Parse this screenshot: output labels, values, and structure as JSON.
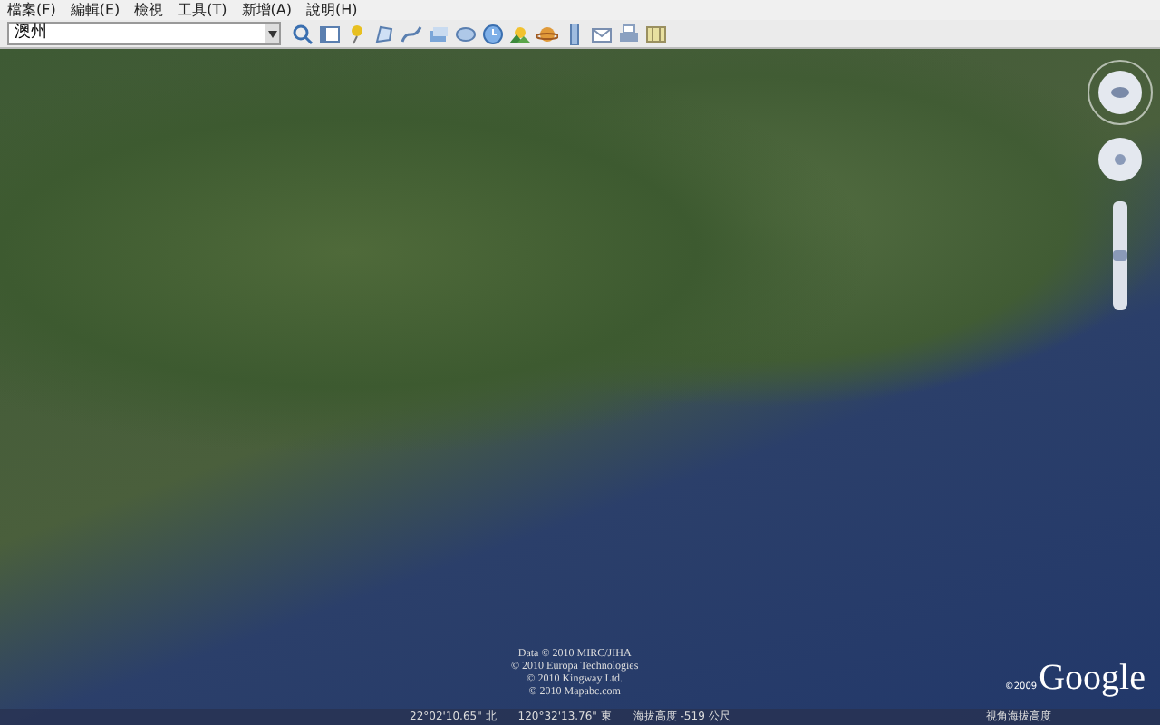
{
  "menu_bar": [
    "檔案(F)",
    "編輯(E)",
    "檢視",
    "工具(T)",
    "新增(A)",
    "說明(H)"
  ],
  "search": {
    "value": "澳州"
  },
  "zoom": {
    "level": 0.5
  },
  "attribution": [
    "Data © 2010 MIRC/JIHA",
    "© 2010 Europa Technologies",
    "© 2010 Kingway Ltd.",
    "© 2010 Mapabc.com"
  ],
  "logo": {
    "year": "©2009",
    "text": "Google"
  },
  "status_bar": {
    "latitude": "22°02'10.65\" 北",
    "longitude": "120°32'13.76\" 東",
    "elevation": "海拔高度 -519 公尺",
    "eye_altitude": "視角海拔高度"
  }
}
